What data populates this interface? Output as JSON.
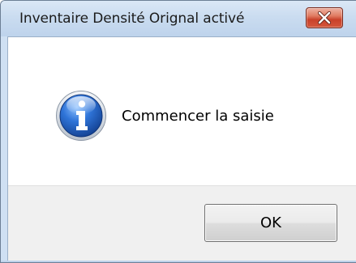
{
  "window": {
    "title": "Inventaire Densité Orignal activé"
  },
  "controls": {
    "close_icon": "close-icon"
  },
  "message": {
    "icon": "info-icon",
    "text": "Commencer la saisie"
  },
  "buttons": {
    "ok_label": "OK"
  },
  "colors": {
    "titlebar": "#cadcf0",
    "close_button": "#c9412a",
    "info_icon": "#2a6ad3",
    "button_area": "#f0f0f0"
  }
}
